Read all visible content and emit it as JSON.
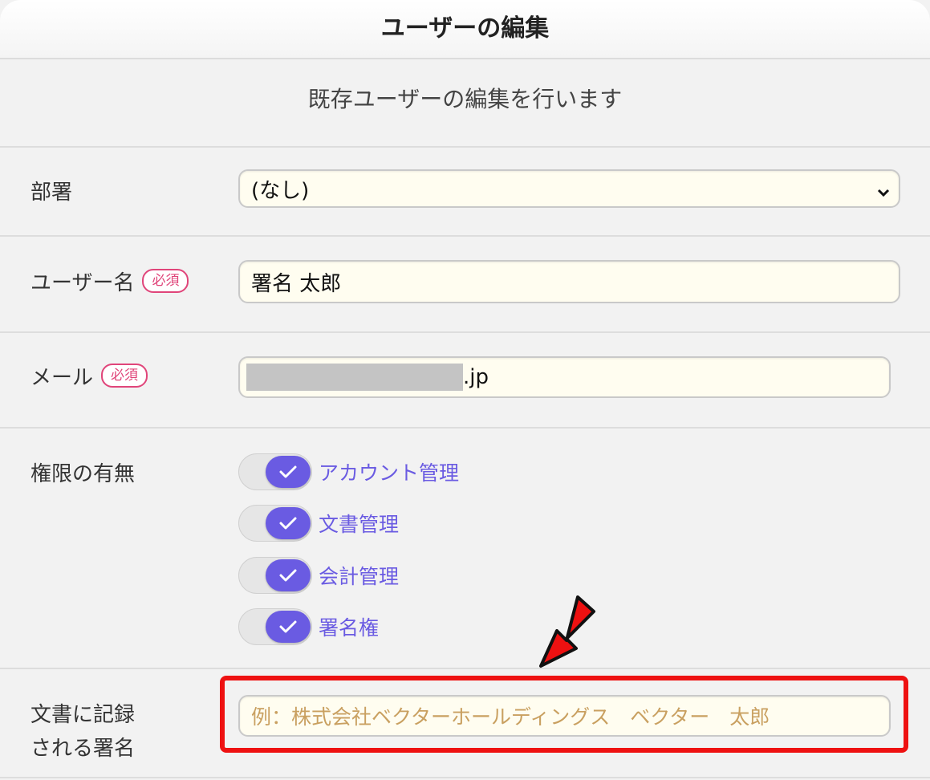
{
  "header": {
    "title": "ユーザーの編集"
  },
  "subtitle": "既存ユーザーの編集を行います",
  "form": {
    "department": {
      "label": "部署",
      "value": "(なし)"
    },
    "username": {
      "label": "ユーザー名",
      "required_badge": "必須",
      "value": "署名 太郎"
    },
    "email": {
      "label": "メール",
      "required_badge": "必須",
      "value_suffix": ".jp"
    },
    "permissions": {
      "label": "権限の有無",
      "items": [
        {
          "label": "アカウント管理",
          "checked": true
        },
        {
          "label": "文書管理",
          "checked": true
        },
        {
          "label": "会計管理",
          "checked": true
        },
        {
          "label": "署名権",
          "checked": true
        }
      ]
    },
    "signature": {
      "label_line1": "文書に記録",
      "label_line2": "される署名",
      "placeholder": "例：株式会社ベクターホールディングス　ベクター　太郎"
    }
  },
  "colors": {
    "accent": "#6a5be2",
    "required": "#e0457a",
    "highlight": "#ee1111",
    "input_bg": "#fffdf0"
  },
  "icons": [
    "check-icon",
    "chevron-down-icon",
    "red-arrow-icon"
  ]
}
